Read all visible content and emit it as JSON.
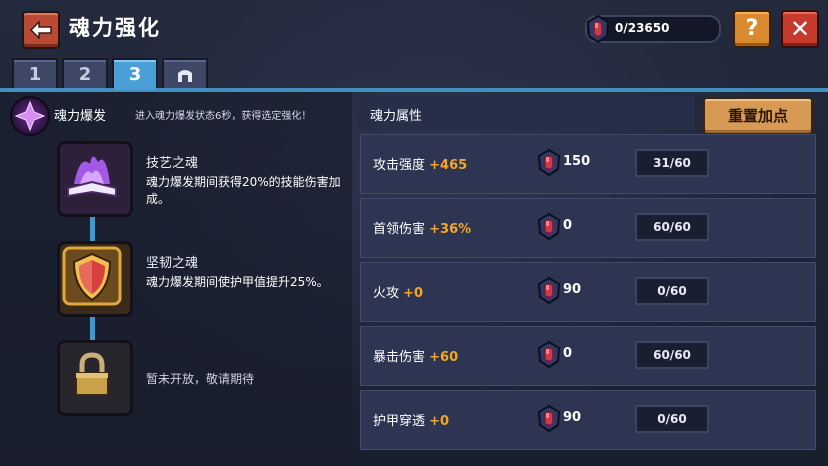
{
  "header": {
    "title": "魂力强化",
    "currency_value": "0/23650",
    "help_label": "?",
    "close_label": "✕"
  },
  "tabs": [
    {
      "label": "1",
      "active": false
    },
    {
      "label": "2",
      "active": false
    },
    {
      "label": "3",
      "active": true
    },
    {
      "label": "",
      "icon": "gate-icon",
      "active": false
    }
  ],
  "burst": {
    "title": "魂力爆发",
    "desc": "进入魂力爆发状态6秒，获得选定强化！"
  },
  "skills": [
    {
      "name": "技艺之魂",
      "desc": "魂力爆发期间获得20%的技能伤害加成。",
      "icon": "purple-flame-book-icon"
    },
    {
      "name": "坚韧之魂",
      "desc": "魂力爆发期间使护甲值提升25%。",
      "icon": "red-shield-icon"
    },
    {
      "name": "",
      "desc": "暂未开放，敬请期待",
      "icon": "padlock-icon"
    }
  ],
  "attributes": {
    "header": "魂力属性",
    "reset_label": "重置加点",
    "rows": [
      {
        "name": "攻击强度",
        "bonus": "+465",
        "cost": "150",
        "level": "31/60"
      },
      {
        "name": "首领伤害",
        "bonus": "+36%",
        "cost": "0",
        "level": "60/60"
      },
      {
        "name": "火攻",
        "bonus": "+0",
        "cost": "90",
        "level": "0/60"
      },
      {
        "name": "暴击伤害",
        "bonus": "+60",
        "cost": "0",
        "level": "60/60"
      },
      {
        "name": "护甲穿透",
        "bonus": "+0",
        "cost": "90",
        "level": "0/60"
      }
    ]
  },
  "colors": {
    "accent_blue": "#4a9fd6",
    "bonus_orange": "#f5a623",
    "close_red": "#c6392d",
    "help_orange": "#d98a2e"
  }
}
